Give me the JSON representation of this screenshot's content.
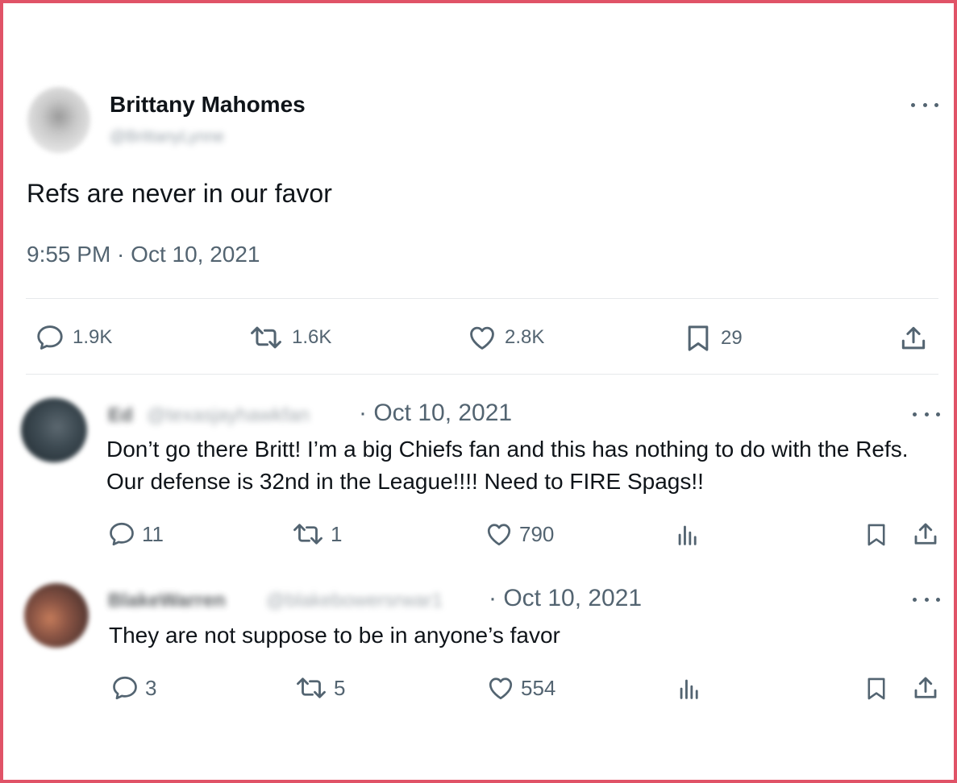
{
  "tweet": {
    "author_name": "Brittany Mahomes",
    "author_handle": "@BrittanyLynne",
    "text": "Refs are never in our favor",
    "timestamp": "9:55 PM · Oct 10, 2021",
    "stats": {
      "replies": "1.9K",
      "retweets": "1.6K",
      "likes": "2.8K",
      "bookmarks": "29"
    },
    "icons": [
      "more-icon",
      "reply-icon",
      "retweet-icon",
      "like-icon",
      "bookmark-icon",
      "share-icon"
    ]
  },
  "replies": [
    {
      "name": "Ed",
      "handle": "@texasjayhawkfan",
      "date": "· Oct 10, 2021",
      "text": "Don’t go there Britt!  I’m a big Chiefs fan and this has nothing to do with the Refs.  Our defense is 32nd in the League!!!! Need to FIRE Spags!!",
      "stats": {
        "replies": "11",
        "retweets": "1",
        "likes": "790"
      }
    },
    {
      "name": "BlakeWarren",
      "handle": "@blakebowersrwar1",
      "date": "· Oct 10, 2021",
      "text": "They are not suppose to be in anyone’s favor",
      "stats": {
        "replies": "3",
        "retweets": "5",
        "likes": "554"
      }
    }
  ],
  "colors": {
    "frame_border": "#e05367",
    "text_primary": "#0f1419",
    "text_secondary": "#536471",
    "divider": "#e6e9eb"
  }
}
